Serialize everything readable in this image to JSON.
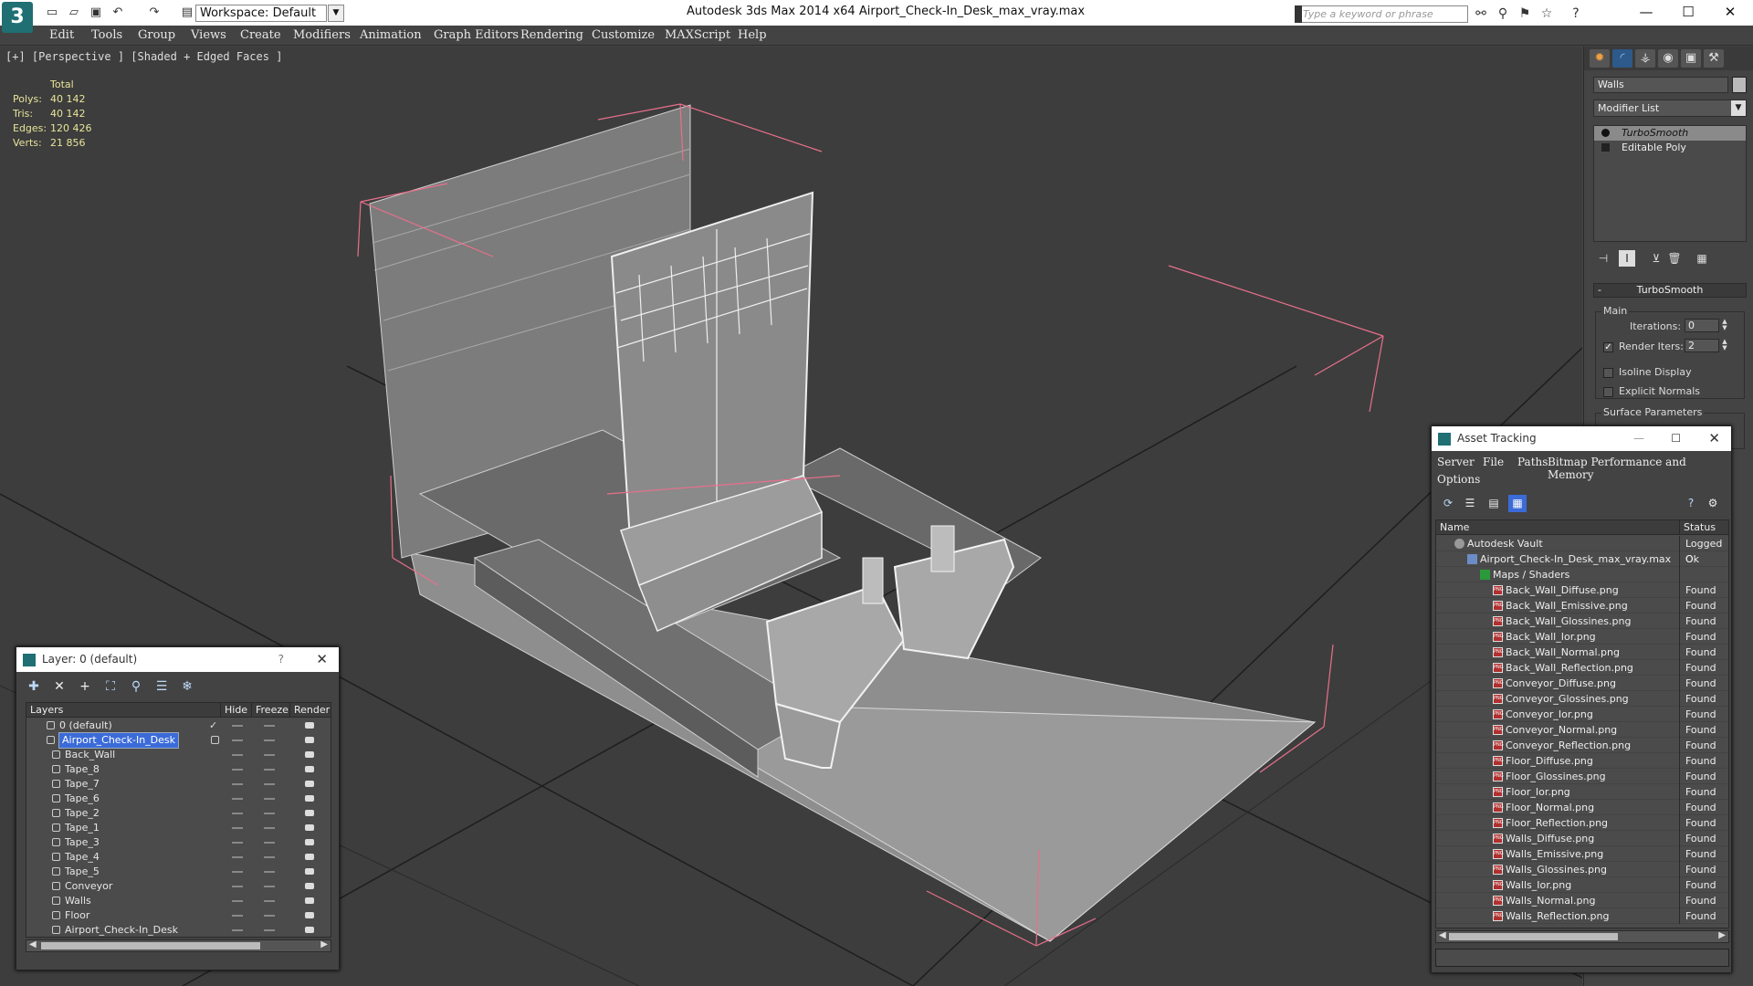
{
  "window": {
    "title": "Autodesk 3ds Max 2014 x64      Airport_Check-In_Desk_max_vray.max",
    "workspace": "Workspace: Default",
    "search_placeholder": "Type a keyword or phrase",
    "minimize": "—",
    "maximize": "☐",
    "close": "✕"
  },
  "menu": [
    "Edit",
    "Tools",
    "Group",
    "Views",
    "Create",
    "Modifiers",
    "Animation",
    "Graph Editors",
    "Rendering",
    "Customize",
    "MAXScript",
    "Help"
  ],
  "viewport": {
    "label": "[+] [Perspective ] [Shaded + Edged Faces ]",
    "stats": {
      "header": "Total",
      "rows": [
        {
          "key": "Polys:",
          "value": "40 142"
        },
        {
          "key": "Tris:",
          "value": "40 142"
        },
        {
          "key": "Edges:",
          "value": "120 426"
        },
        {
          "key": "Verts:",
          "value": "21 856"
        }
      ]
    }
  },
  "command_panel": {
    "object_name": "Walls",
    "modifier_list": "Modifier List",
    "stack": [
      {
        "label": "TurboSmooth",
        "selected": true
      },
      {
        "label": "Editable Poly",
        "selected": false
      }
    ],
    "rollout_title": "TurboSmooth",
    "main_group": "Main",
    "iterations_label": "Iterations:",
    "iterations_value": "0",
    "render_iters_label": "Render Iters:",
    "render_iters_value": "2",
    "isoline_label": "Isoline Display",
    "explicit_label": "Explicit Normals",
    "surface_group": "Surface Parameters"
  },
  "layer_dialog": {
    "title": "Layer: 0 (default)",
    "help": "?",
    "columns": [
      "Layers",
      "Hide",
      "Freeze",
      "Render"
    ],
    "rows": [
      {
        "name": "0 (default)",
        "level": 0,
        "checked": true,
        "selected": false
      },
      {
        "name": "Airport_Check-In_Desk",
        "level": 0,
        "checked": false,
        "selected": true
      },
      {
        "name": "Back_Wall",
        "level": 1
      },
      {
        "name": "Tape_8",
        "level": 1
      },
      {
        "name": "Tape_7",
        "level": 1
      },
      {
        "name": "Tape_6",
        "level": 1
      },
      {
        "name": "Tape_2",
        "level": 1
      },
      {
        "name": "Tape_1",
        "level": 1
      },
      {
        "name": "Tape_3",
        "level": 1
      },
      {
        "name": "Tape_4",
        "level": 1
      },
      {
        "name": "Tape_5",
        "level": 1
      },
      {
        "name": "Conveyor",
        "level": 1
      },
      {
        "name": "Walls",
        "level": 1
      },
      {
        "name": "Floor",
        "level": 1
      },
      {
        "name": "Airport_Check-In_Desk",
        "level": 1
      }
    ]
  },
  "asset_tracking": {
    "title": "Asset Tracking",
    "menu": [
      "Server",
      "File",
      "Paths",
      "Bitmap Performance and Memory",
      "Options"
    ],
    "columns": [
      "Name",
      "Status"
    ],
    "rows": [
      {
        "name": "Autodesk Vault",
        "status": "Logged O",
        "icon": "vault",
        "indent": 0
      },
      {
        "name": "Airport_Check-In_Desk_max_vray.max",
        "status": "Ok",
        "icon": "max",
        "indent": 1
      },
      {
        "name": "Maps / Shaders",
        "status": "",
        "icon": "maps",
        "indent": 2
      },
      {
        "name": "Back_Wall_Diffuse.png",
        "status": "Found",
        "icon": "png",
        "indent": 3
      },
      {
        "name": "Back_Wall_Emissive.png",
        "status": "Found",
        "icon": "png",
        "indent": 3
      },
      {
        "name": "Back_Wall_Glossines.png",
        "status": "Found",
        "icon": "png",
        "indent": 3
      },
      {
        "name": "Back_Wall_Ior.png",
        "status": "Found",
        "icon": "png",
        "indent": 3
      },
      {
        "name": "Back_Wall_Normal.png",
        "status": "Found",
        "icon": "png",
        "indent": 3
      },
      {
        "name": "Back_Wall_Reflection.png",
        "status": "Found",
        "icon": "png",
        "indent": 3
      },
      {
        "name": "Conveyor_Diffuse.png",
        "status": "Found",
        "icon": "png",
        "indent": 3
      },
      {
        "name": "Conveyor_Glossines.png",
        "status": "Found",
        "icon": "png",
        "indent": 3
      },
      {
        "name": "Conveyor_Ior.png",
        "status": "Found",
        "icon": "png",
        "indent": 3
      },
      {
        "name": "Conveyor_Normal.png",
        "status": "Found",
        "icon": "png",
        "indent": 3
      },
      {
        "name": "Conveyor_Reflection.png",
        "status": "Found",
        "icon": "png",
        "indent": 3
      },
      {
        "name": "Floor_Diffuse.png",
        "status": "Found",
        "icon": "png",
        "indent": 3
      },
      {
        "name": "Floor_Glossines.png",
        "status": "Found",
        "icon": "png",
        "indent": 3
      },
      {
        "name": "Floor_Ior.png",
        "status": "Found",
        "icon": "png",
        "indent": 3
      },
      {
        "name": "Floor_Normal.png",
        "status": "Found",
        "icon": "png",
        "indent": 3
      },
      {
        "name": "Floor_Reflection.png",
        "status": "Found",
        "icon": "png",
        "indent": 3
      },
      {
        "name": "Walls_Diffuse.png",
        "status": "Found",
        "icon": "png",
        "indent": 3
      },
      {
        "name": "Walls_Emissive.png",
        "status": "Found",
        "icon": "png",
        "indent": 3
      },
      {
        "name": "Walls_Glossines.png",
        "status": "Found",
        "icon": "png",
        "indent": 3
      },
      {
        "name": "Walls_Ior.png",
        "status": "Found",
        "icon": "png",
        "indent": 3
      },
      {
        "name": "Walls_Normal.png",
        "status": "Found",
        "icon": "png",
        "indent": 3
      },
      {
        "name": "Walls_Reflection.png",
        "status": "Found",
        "icon": "png",
        "indent": 3
      }
    ]
  },
  "colors": {
    "viewport_bg": "#3d3d3d",
    "stats_text": "#e8e49a",
    "selection": "#3b6bd9",
    "bbox": "#e8708c"
  }
}
